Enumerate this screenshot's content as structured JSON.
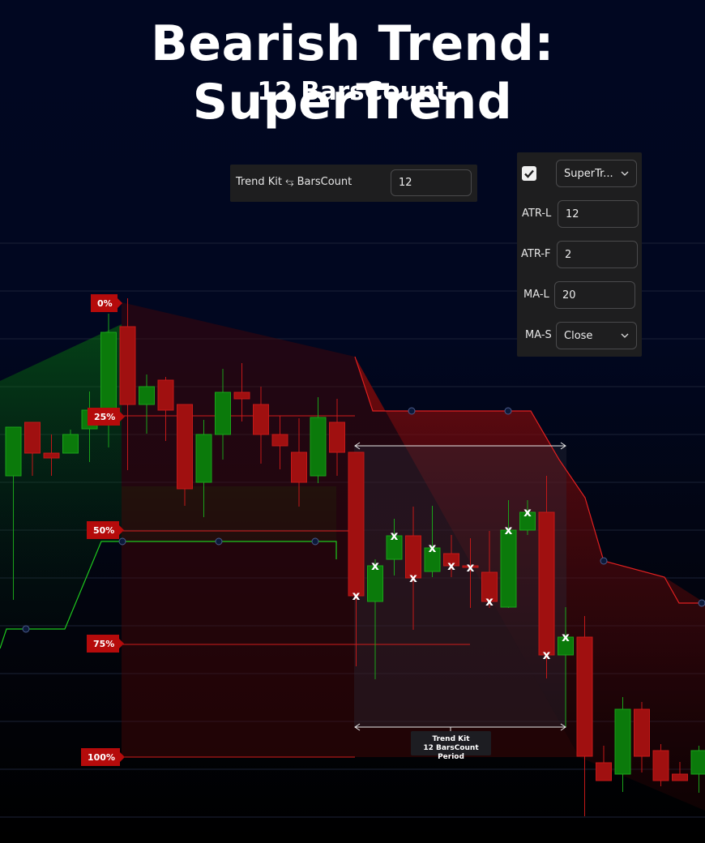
{
  "title": "Bearish Trend: SuperTrend",
  "subtitle": "12 BarsCount",
  "barscount_panel": {
    "label": "Trend Kit ⥃ BarsCount",
    "value": "12"
  },
  "supertrend_panel": {
    "checked": true,
    "indicator": "SuperTr...",
    "atr_l_label": "ATR-L",
    "atr_l_value": "12",
    "atr_f_label": "ATR-F",
    "atr_f_value": "2",
    "ma_l_label": "MA-L",
    "ma_l_value": "20",
    "ma_s_label": "MA-S",
    "ma_s_value": "Close"
  },
  "level_tags": [
    "0%",
    "25%",
    "50%",
    "75%",
    "100%"
  ],
  "period_label": {
    "line1": "Trend Kit",
    "line2": "12 BarsCount Period"
  },
  "colors": {
    "bull": "#1aa31a",
    "bear": "#c31818",
    "tag": "#b50b0b",
    "background": "#010721"
  },
  "chart_data": {
    "type": "candlestick",
    "title": "",
    "price_range": [
      0,
      1000
    ],
    "marker": "x",
    "candles": [
      {
        "o": 587,
        "h": 740,
        "l": 581,
        "c": 527
      },
      {
        "o": 521,
        "h": 521,
        "l": 587,
        "c": 559
      },
      {
        "o": 559,
        "h": 536,
        "l": 587,
        "c": 565
      },
      {
        "o": 559,
        "h": 530,
        "l": 559,
        "c": 536
      },
      {
        "o": 529,
        "h": 483,
        "l": 570,
        "c": 506
      },
      {
        "o": 506,
        "h": 387,
        "l": 552,
        "c": 410
      },
      {
        "o": 403,
        "h": 368,
        "l": 580,
        "c": 499
      },
      {
        "o": 499,
        "h": 462,
        "l": 535,
        "c": 477
      },
      {
        "o": 469,
        "h": 465,
        "l": 544,
        "c": 506
      },
      {
        "o": 499,
        "h": 499,
        "l": 624,
        "c": 603
      },
      {
        "o": 595,
        "h": 518,
        "l": 638,
        "c": 536
      },
      {
        "o": 536,
        "h": 455,
        "l": 567,
        "c": 484
      },
      {
        "o": 484,
        "h": 448,
        "l": 520,
        "c": 492
      },
      {
        "o": 499,
        "h": 477,
        "l": 572,
        "c": 536
      },
      {
        "o": 536,
        "h": 513,
        "l": 579,
        "c": 550
      },
      {
        "o": 558,
        "h": 516,
        "l": 625,
        "c": 595
      },
      {
        "o": 587,
        "h": 490,
        "l": 596,
        "c": 515
      },
      {
        "o": 521,
        "h": 492,
        "l": 587,
        "c": 558
      },
      {
        "o": 558,
        "h": 559,
        "l": 822,
        "c": 735,
        "m": "x"
      },
      {
        "o": 742,
        "h": 690,
        "l": 838,
        "c": 698,
        "m": "x"
      },
      {
        "o": 690,
        "h": 640,
        "l": 710,
        "c": 661,
        "m": "x"
      },
      {
        "o": 661,
        "h": 625,
        "l": 777,
        "c": 713,
        "m": "x"
      },
      {
        "o": 705,
        "h": 624,
        "l": 712,
        "c": 676,
        "m": "x"
      },
      {
        "o": 683,
        "h": 660,
        "l": 712,
        "c": 698,
        "m": "x"
      },
      {
        "o": 698,
        "h": 664,
        "l": 750,
        "c": 698,
        "m": "x"
      },
      {
        "o": 706,
        "h": 655,
        "l": 750,
        "c": 742,
        "m": "x"
      },
      {
        "o": 749,
        "h": 617,
        "l": 750,
        "c": 654,
        "m": "x"
      },
      {
        "o": 654,
        "h": 617,
        "l": 660,
        "c": 632,
        "m": "x"
      },
      {
        "o": 632,
        "h": 587,
        "l": 837,
        "c": 808,
        "m": "x"
      },
      {
        "o": 808,
        "h": 749,
        "l": 897,
        "c": 786,
        "m": "x"
      },
      {
        "o": 786,
        "h": 760,
        "l": 1007,
        "c": 933
      },
      {
        "o": 941,
        "h": 920,
        "l": 963,
        "c": 963
      },
      {
        "o": 955,
        "h": 860,
        "l": 977,
        "c": 875
      },
      {
        "o": 875,
        "h": 866,
        "l": 953,
        "c": 933
      },
      {
        "o": 926,
        "h": 918,
        "l": 970,
        "c": 963
      },
      {
        "o": 955,
        "h": 940,
        "l": 963,
        "c": 963
      },
      {
        "o": 955,
        "h": 920,
        "l": 978,
        "c": 926
      }
    ],
    "levels": [
      {
        "label": "0%",
        "price": 373
      },
      {
        "label": "25%",
        "price": 513
      },
      {
        "label": "50%",
        "price": 655
      },
      {
        "label": "75%",
        "price": 795
      },
      {
        "label": "100%",
        "price": 934
      }
    ]
  }
}
